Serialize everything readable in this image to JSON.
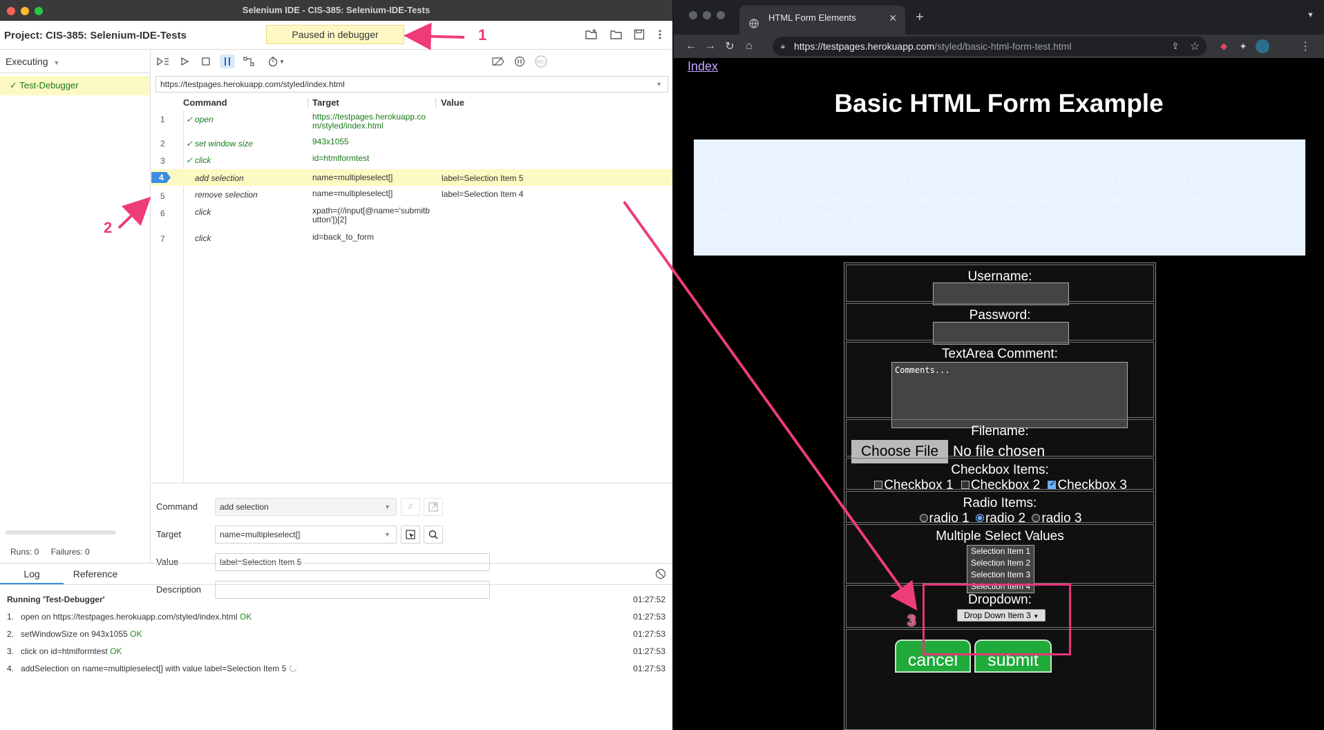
{
  "ide": {
    "window_title": "Selenium IDE - CIS-385: Selenium-IDE-Tests",
    "project_label": "Project:  CIS-385: Selenium-IDE-Tests",
    "status_badge": "Paused in debugger",
    "executing_label": "Executing",
    "test_name": "Test-Debugger",
    "runs_label": "Runs: 0",
    "failures_label": "Failures: 0",
    "base_url": "https://testpages.herokuapp.com/styled/index.html",
    "columns": {
      "command": "Command",
      "target": "Target",
      "value": "Value"
    },
    "rows": [
      {
        "num": "1",
        "command": "open",
        "target": "https://testpages.herokuapp.com/styled/index.html",
        "value": "",
        "status": "ok"
      },
      {
        "num": "2",
        "command": "set window size",
        "target": "943x1055",
        "value": "",
        "status": "ok"
      },
      {
        "num": "3",
        "command": "click",
        "target": "id=htmlformtest",
        "value": "",
        "status": "ok"
      },
      {
        "num": "4",
        "command": "add selection",
        "target": "name=multipleselect[]",
        "value": "label=Selection Item 5",
        "status": "current"
      },
      {
        "num": "5",
        "command": "remove selection",
        "target": "name=multipleselect[]",
        "value": "label=Selection Item 4",
        "status": "pending"
      },
      {
        "num": "6",
        "command": "click",
        "target": "xpath=(//input[@name='submitbutton'])[2]",
        "value": "",
        "status": "pending"
      },
      {
        "num": "7",
        "command": "click",
        "target": "id=back_to_form",
        "value": "",
        "status": "pending"
      }
    ],
    "editor": {
      "command_label": "Command",
      "command_value": "add selection",
      "target_label": "Target",
      "target_value": "name=multipleselect[]",
      "value_label": "Value",
      "value_value": "label=Selection Item 5",
      "description_label": "Description",
      "description_value": ""
    },
    "log_tabs": [
      "Log",
      "Reference"
    ],
    "log_header": "Running 'Test-Debugger'",
    "log_header_time": "01:27:52",
    "log_lines": [
      {
        "num": "1.",
        "text": "open on https://testpages.herokuapp.com/styled/index.html",
        "result": "OK",
        "time": "01:27:53"
      },
      {
        "num": "2.",
        "text": "setWindowSize on 943x1055",
        "result": "OK",
        "time": "01:27:53"
      },
      {
        "num": "3.",
        "text": "click on id=htmlformtest",
        "result": "OK",
        "time": "01:27:53"
      },
      {
        "num": "4.",
        "text": "addSelection on name=multipleselect[] with value label=Selection Item 5",
        "result": "",
        "time": "01:27:53"
      }
    ]
  },
  "browser": {
    "tab_title": "HTML Form Elements",
    "url_host": "https://testpages.herokuapp.com",
    "url_path": "/styled/basic-html-form-test.html",
    "page": {
      "index_link": "Index",
      "title": "Basic HTML Form Example",
      "intro": "HTML uses form elements with sub input, label, textarea, select and option elements. This form is formatted using a table element. Submiting a form will POST the information to another part of the application.",
      "username_label": "Username:",
      "password_label": "Password:",
      "textarea_label": "TextArea Comment:",
      "textarea_value": "Comments...",
      "filename_label": "Filename:",
      "choose_file": "Choose File",
      "no_file": "No file chosen",
      "checkbox_label": "Checkbox Items:",
      "checkboxes": [
        {
          "label": "Checkbox 1",
          "checked": false
        },
        {
          "label": "Checkbox 2",
          "checked": false
        },
        {
          "label": "Checkbox 3",
          "checked": true
        }
      ],
      "radio_label": "Radio Items:",
      "radios": [
        {
          "label": "radio 1",
          "checked": false
        },
        {
          "label": "radio 2",
          "checked": true
        },
        {
          "label": "radio 3",
          "checked": false
        }
      ],
      "multiselect_label": "Multiple Select Values",
      "multiselect_items": [
        "Selection Item 1",
        "Selection Item 2",
        "Selection Item 3",
        "Selection Item 4"
      ],
      "dropdown_label": "Dropdown:",
      "dropdown_value": "Drop Down Item 3",
      "cancel_button": "cancel",
      "submit_button": "submit"
    }
  },
  "annotations": [
    "1",
    "2",
    "3"
  ],
  "colors": {
    "annotation": "#ee3c77",
    "breakpoint": "#3d8ee0",
    "ok_green": "#1a7a1a",
    "highlight_yellow": "#fdf9c3"
  }
}
